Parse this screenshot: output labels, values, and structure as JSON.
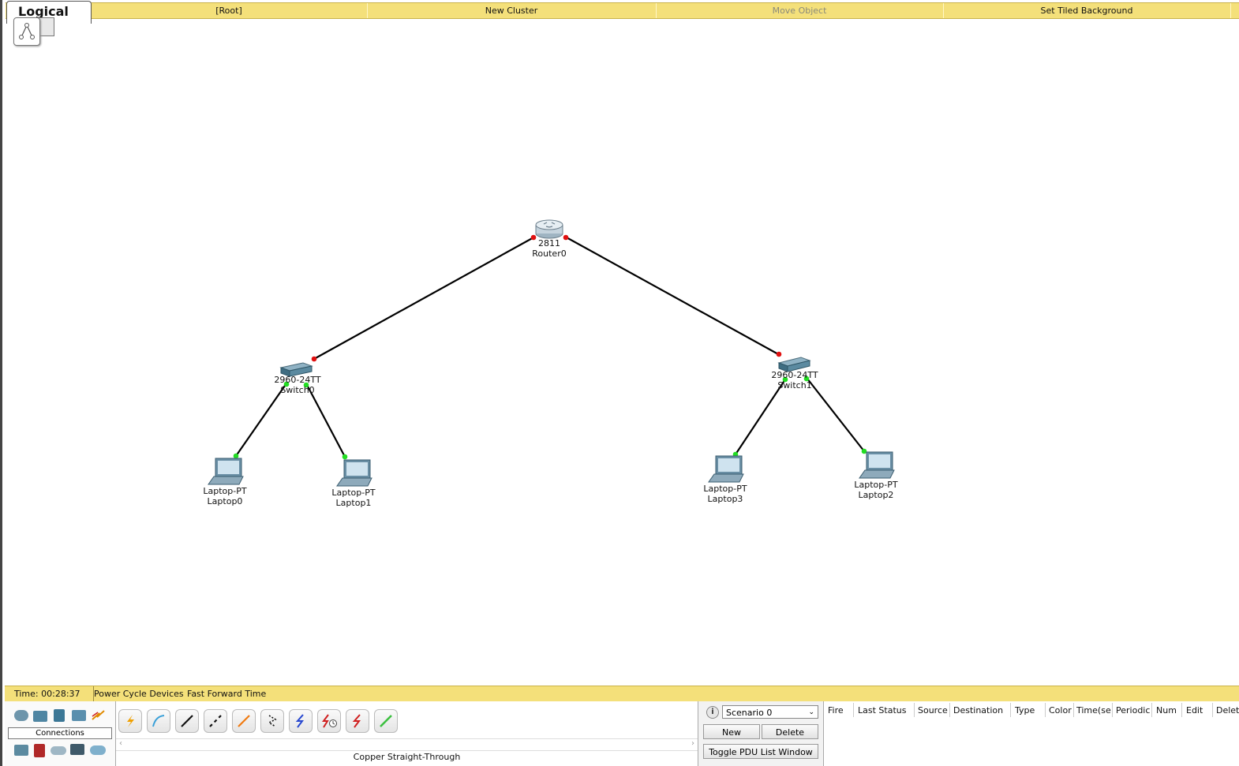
{
  "toolbar": {
    "tab_label": "Logical",
    "root_label": "[Root]",
    "new_cluster_label": "New Cluster",
    "move_object_label": "Move Object",
    "set_tiled_background_label": "Set Tiled Background"
  },
  "topology": {
    "router0": {
      "model": "2811",
      "name": "Router0"
    },
    "switch0": {
      "model": "2960-24TT",
      "name": "Switch0"
    },
    "switch1": {
      "model": "2960-24TT",
      "name": "Switch1"
    },
    "laptop0": {
      "model": "Laptop-PT",
      "name": "Laptop0"
    },
    "laptop1": {
      "model": "Laptop-PT",
      "name": "Laptop1"
    },
    "laptop3": {
      "model": "Laptop-PT",
      "name": "Laptop3"
    },
    "laptop2": {
      "model": "Laptop-PT",
      "name": "Laptop2"
    },
    "colors": {
      "link": "#000000",
      "port_down": "#e01010",
      "port_up": "#22dd22"
    }
  },
  "status": {
    "time": "Time: 00:28:37",
    "power_cycle_label": "Power Cycle Devices",
    "fast_forward_label": "Fast Forward Time"
  },
  "device_panel": {
    "category_label": "Connections",
    "selected_cable": "Copper Straight-Through"
  },
  "scenario": {
    "selected": "Scenario 0",
    "new_label": "New",
    "delete_label": "Delete",
    "toggle_label": "Toggle PDU List Window"
  },
  "pdu_columns": [
    "Fire",
    "Last Status",
    "Source",
    "Destination",
    "Type",
    "Color",
    "Time(se",
    "Periodic",
    "Num",
    "Edit",
    "Delete"
  ]
}
